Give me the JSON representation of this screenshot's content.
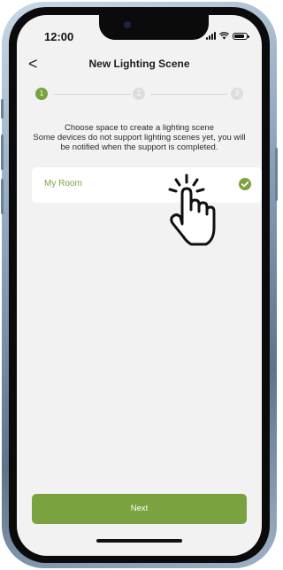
{
  "status_bar": {
    "time": "12:00"
  },
  "header": {
    "back_symbol": "<",
    "title": "New Lighting Scene"
  },
  "stepper": {
    "steps": [
      "1",
      "2",
      "3"
    ],
    "active_step": 1
  },
  "instructions": {
    "line1": "Choose space to create a lighting scene",
    "line2": "Some devices do not support lighting scenes yet, you will be notified when the support is completed."
  },
  "rooms": [
    {
      "name": "My Room",
      "selected": true
    }
  ],
  "footer": {
    "next_label": "Next"
  },
  "colors": {
    "accent": "#7aa33f",
    "background": "#f2f2f2"
  },
  "icons": {
    "back": "chevron-left-icon",
    "selected": "check-circle-icon",
    "overlay": "tap-hand-icon",
    "signal": "signal-icon",
    "wifi": "wifi-icon",
    "battery": "battery-icon"
  }
}
